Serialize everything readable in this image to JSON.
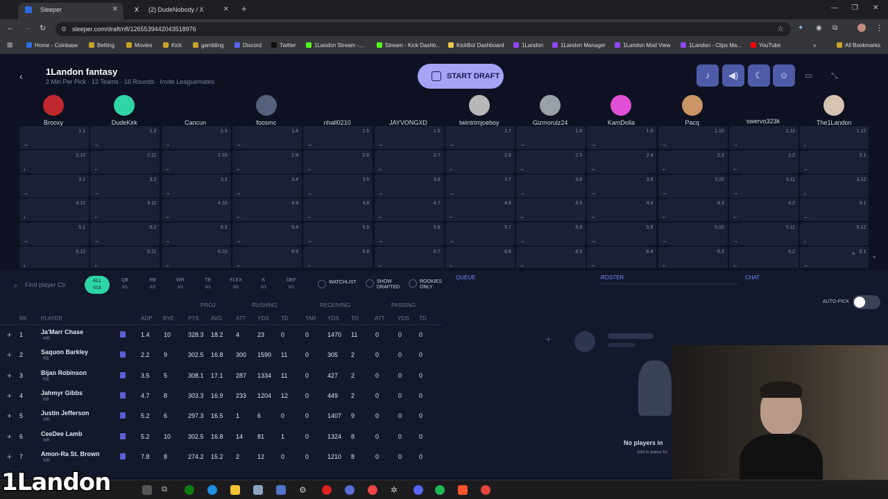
{
  "browser": {
    "tabs": [
      {
        "title": "Sleeper",
        "active": true
      },
      {
        "title": "(2) DudeNobody / X",
        "active": false
      }
    ],
    "new_tab": "+",
    "url": "sleeper.com/draft/nfl/1265539442043518976",
    "bookmarks": [
      "Home - Coinbase",
      "Betting",
      "Movies",
      "Kick",
      "gambling",
      "Discord",
      "Twitter",
      "1Landon Stream -...",
      "Stream - Kick Dashb...",
      "KickBot Dashboard",
      "1Landon",
      "1Landon Manager",
      "1Landon Mod View",
      "1Landon - Clips Ma...",
      "YouTube"
    ],
    "all_bookmarks": "All Bookmarks"
  },
  "header": {
    "title": "1Landon fantasy",
    "subtitle": "2 Min Per Pick · 12 Teams · 16 Rounds · Invite Leaguemates",
    "start_draft": "START DRAFT"
  },
  "teams": [
    "Brooxy",
    "DudeKirk",
    "Cancun",
    "foosmc",
    "nhall0210",
    "JAYVONGXD",
    "twintrimjoeboy",
    "Gizmorulz24",
    "KamDolla",
    "Pacq",
    "swervo323k",
    "The1Landon"
  ],
  "board_rounds": [
    [
      "1.1",
      "1.2",
      "1.3",
      "1.4",
      "1.5",
      "1.6",
      "1.7",
      "1.8",
      "1.9",
      "1.10",
      "1.11",
      "1.12"
    ],
    [
      "2.12",
      "2.11",
      "2.10",
      "2.9",
      "2.8",
      "2.7",
      "2.6",
      "2.5",
      "2.4",
      "2.3",
      "2.2",
      "2.1"
    ],
    [
      "3.1",
      "3.2",
      "3.3",
      "3.4",
      "3.5",
      "3.6",
      "3.7",
      "3.8",
      "3.9",
      "3.10",
      "3.11",
      "3.12"
    ],
    [
      "4.12",
      "4.11",
      "4.10",
      "4.9",
      "4.8",
      "4.7",
      "4.6",
      "4.5",
      "4.4",
      "4.3",
      "4.2",
      "4.1"
    ],
    [
      "5.1",
      "5.2",
      "5.3",
      "5.4",
      "5.5",
      "5.6",
      "5.7",
      "5.8",
      "5.9",
      "5.10",
      "5.11",
      "5.12"
    ],
    [
      "6.12",
      "6.11",
      "6.10",
      "6.9",
      "6.8",
      "6.7",
      "6.6",
      "6.5",
      "6.4",
      "6.3",
      "6.2",
      "6.1"
    ]
  ],
  "filters": {
    "search_placeholder": "Find player Ctr",
    "positions": [
      {
        "label": "ALL",
        "count": "0/16"
      },
      {
        "label": "QB",
        "count": "0/1"
      },
      {
        "label": "RB",
        "count": "0/2"
      },
      {
        "label": "WR",
        "count": "0/2"
      },
      {
        "label": "TE",
        "count": "0/1"
      },
      {
        "label": "FLEX",
        "count": "0/2"
      },
      {
        "label": "K",
        "count": "0/1"
      },
      {
        "label": "DEF",
        "count": "0/1"
      }
    ],
    "watchlist": "WATCHLIST",
    "show_drafted": "SHOW DRAFTED",
    "rookies_only": "ROOKIES ONLY"
  },
  "table": {
    "groups": {
      "proj": "PROJ",
      "rushing": "RUSHING",
      "receiving": "RECEIVING",
      "passing": "PASSING"
    },
    "columns": [
      "RK",
      "PLAYER",
      "ADP",
      "BYE",
      "PTS",
      "AVG",
      "ATT",
      "YDS",
      "TD",
      "TAR",
      "YDS",
      "TD",
      "ATT",
      "YDS",
      "TD"
    ],
    "rows": [
      {
        "rk": "1",
        "name": "Ja'Marr Chase",
        "pos": "WR",
        "adp": "1.4",
        "bye": "10",
        "pts": "328.3",
        "avg": "18.2",
        "ratt": "4",
        "ryds": "23",
        "rtd": "0",
        "tar": "0",
        "recyds": "1470",
        "rectd": "11",
        "patt": "0",
        "pyds": "0",
        "ptd": "0"
      },
      {
        "rk": "2",
        "name": "Saquon Barkley",
        "pos": "RB",
        "adp": "2.2",
        "bye": "9",
        "pts": "302.5",
        "avg": "16.8",
        "ratt": "300",
        "ryds": "1590",
        "rtd": "11",
        "tar": "0",
        "recyds": "305",
        "rectd": "2",
        "patt": "0",
        "pyds": "0",
        "ptd": "0"
      },
      {
        "rk": "3",
        "name": "Bijan Robinson",
        "pos": "RB",
        "adp": "3.5",
        "bye": "5",
        "pts": "308.1",
        "avg": "17.1",
        "ratt": "287",
        "ryds": "1334",
        "rtd": "11",
        "tar": "0",
        "recyds": "427",
        "rectd": "2",
        "patt": "0",
        "pyds": "0",
        "ptd": "0"
      },
      {
        "rk": "4",
        "name": "Jahmyr Gibbs",
        "pos": "RB",
        "adp": "4.7",
        "bye": "8",
        "pts": "303.3",
        "avg": "16.9",
        "ratt": "233",
        "ryds": "1204",
        "rtd": "12",
        "tar": "0",
        "recyds": "449",
        "rectd": "2",
        "patt": "0",
        "pyds": "0",
        "ptd": "0"
      },
      {
        "rk": "5",
        "name": "Justin Jefferson",
        "pos": "WR",
        "adp": "5.2",
        "bye": "6",
        "pts": "297.3",
        "avg": "16.5",
        "ratt": "1",
        "ryds": "6",
        "rtd": "0",
        "tar": "0",
        "recyds": "1407",
        "rectd": "9",
        "patt": "0",
        "pyds": "0",
        "ptd": "0"
      },
      {
        "rk": "6",
        "name": "CeeDee Lamb",
        "pos": "WR",
        "adp": "5.2",
        "bye": "10",
        "pts": "302.5",
        "avg": "16.8",
        "ratt": "14",
        "ryds": "81",
        "rtd": "1",
        "tar": "0",
        "recyds": "1324",
        "rectd": "8",
        "patt": "0",
        "pyds": "0",
        "ptd": "0"
      },
      {
        "rk": "7",
        "name": "Amon-Ra St. Brown",
        "pos": "WR",
        "adp": "7.8",
        "bye": "8",
        "pts": "274.2",
        "avg": "15.2",
        "ratt": "2",
        "ryds": "12",
        "rtd": "0",
        "tar": "0",
        "recyds": "1210",
        "rectd": "8",
        "patt": "0",
        "pyds": "0",
        "ptd": "0"
      }
    ]
  },
  "right_panel": {
    "queue": "QUEUE",
    "roster": "ROSTER",
    "chat": "CHAT",
    "auto_pick": "AUTO-PICK",
    "empty_title": "No players in",
    "empty_sub": "Add to queue fro"
  },
  "overlay_text": "1Landon",
  "colors": {
    "accent": "#2fd5a5",
    "start_draft": "#a6a2f5",
    "board_cell": "#1a2036",
    "bg": "#0d1121"
  }
}
